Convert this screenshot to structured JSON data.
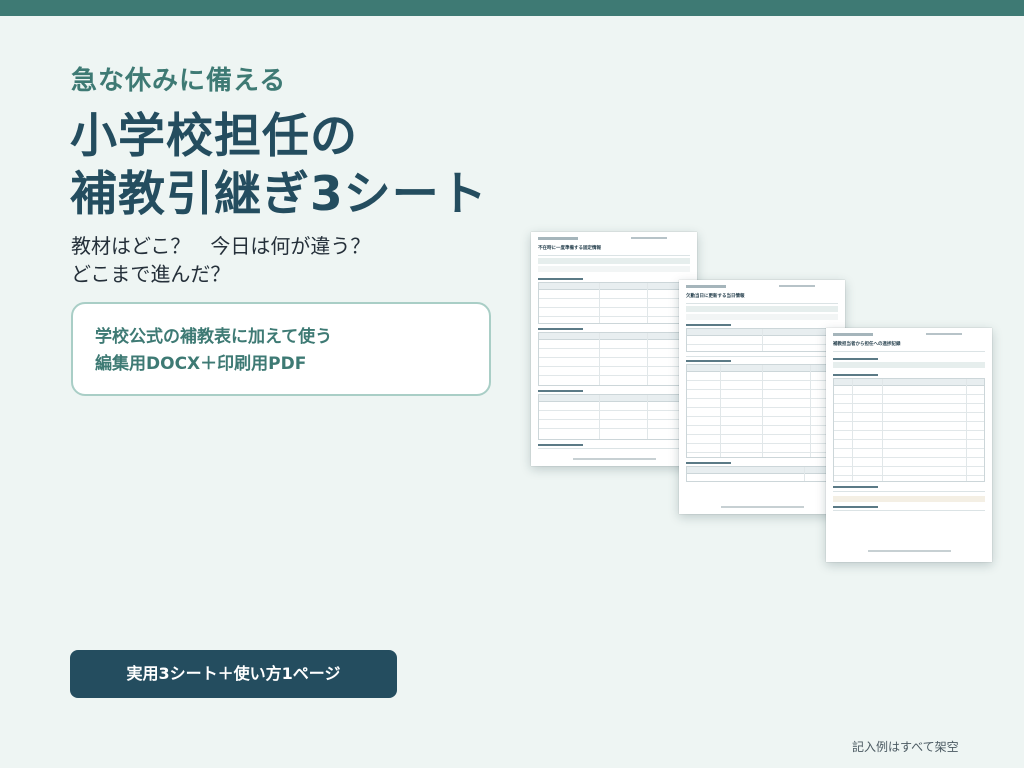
{
  "eyebrow": "急な休みに備える",
  "title": {
    "line1": "小学校担任の",
    "line2": "補教引継ぎ3シート"
  },
  "subcopy": {
    "line1": "教材はどこ？　今日は何が違う？",
    "line2": "どこまで進んだ？"
  },
  "callout": {
    "line1": "学校公式の補教表に加えて使う",
    "line2": "編集用DOCX＋印刷用PDF"
  },
  "cta_label": "実用3シート＋使い方1ページ",
  "footnote": "記入例はすべて架空",
  "sheets": [
    {
      "title": "不在時に一度準備する固定情報"
    },
    {
      "title": "欠勤当日に更新する当日情報"
    },
    {
      "title": "補教担当者から担任への進捗記録"
    }
  ],
  "colors": {
    "top_bar": "#3e7a74",
    "accent_green": "#3e7a74",
    "navy": "#244d5f",
    "background": "#eef5f3"
  }
}
